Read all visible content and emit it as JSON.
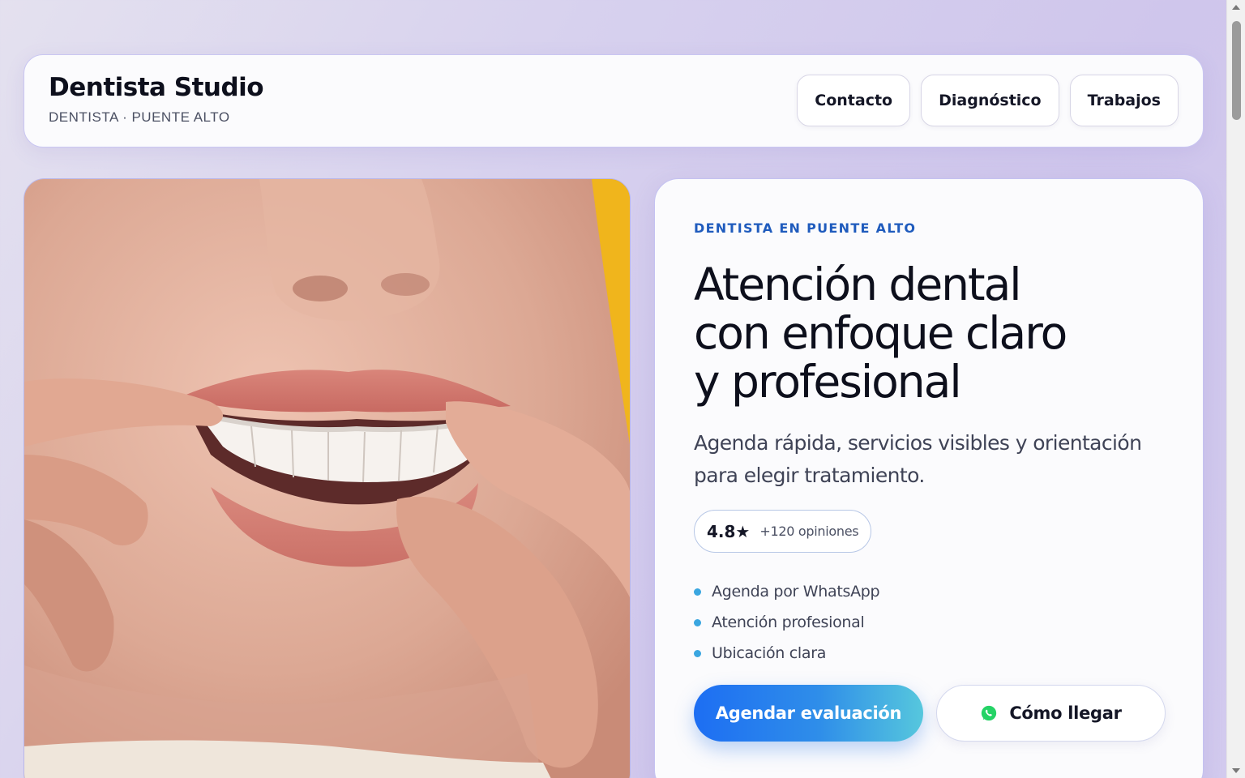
{
  "header": {
    "brand": "Dentista Studio",
    "tagline": "DENTISTA · PUENTE ALTO",
    "nav": [
      "Contacto",
      "Diagnóstico",
      "Trabajos"
    ]
  },
  "hero": {
    "eyebrow": "DENTISTA EN PUENTE ALTO",
    "headline": [
      "Atención dental",
      "con enfoque claro",
      "y profesional"
    ],
    "lead": "Agenda rápida, servicios visibles y orientación para elegir tratamiento.",
    "rating": {
      "value": "4.8★",
      "count": "+120 opiniones"
    },
    "bullets": [
      "Agenda por WhatsApp",
      "Atención profesional",
      "Ubicación clara"
    ],
    "primary_cta": "Agendar evaluación",
    "secondary_cta": "Cómo llegar"
  },
  "icons": {
    "secondary_cta_icon": "whatsapp-icon"
  },
  "colors": {
    "accent": "#1f5bbd",
    "cta_start": "#1d6ef3",
    "cta_end": "#56c7dd",
    "bullet_dot": "#3aa6e0",
    "whatsapp": "#25d366"
  }
}
